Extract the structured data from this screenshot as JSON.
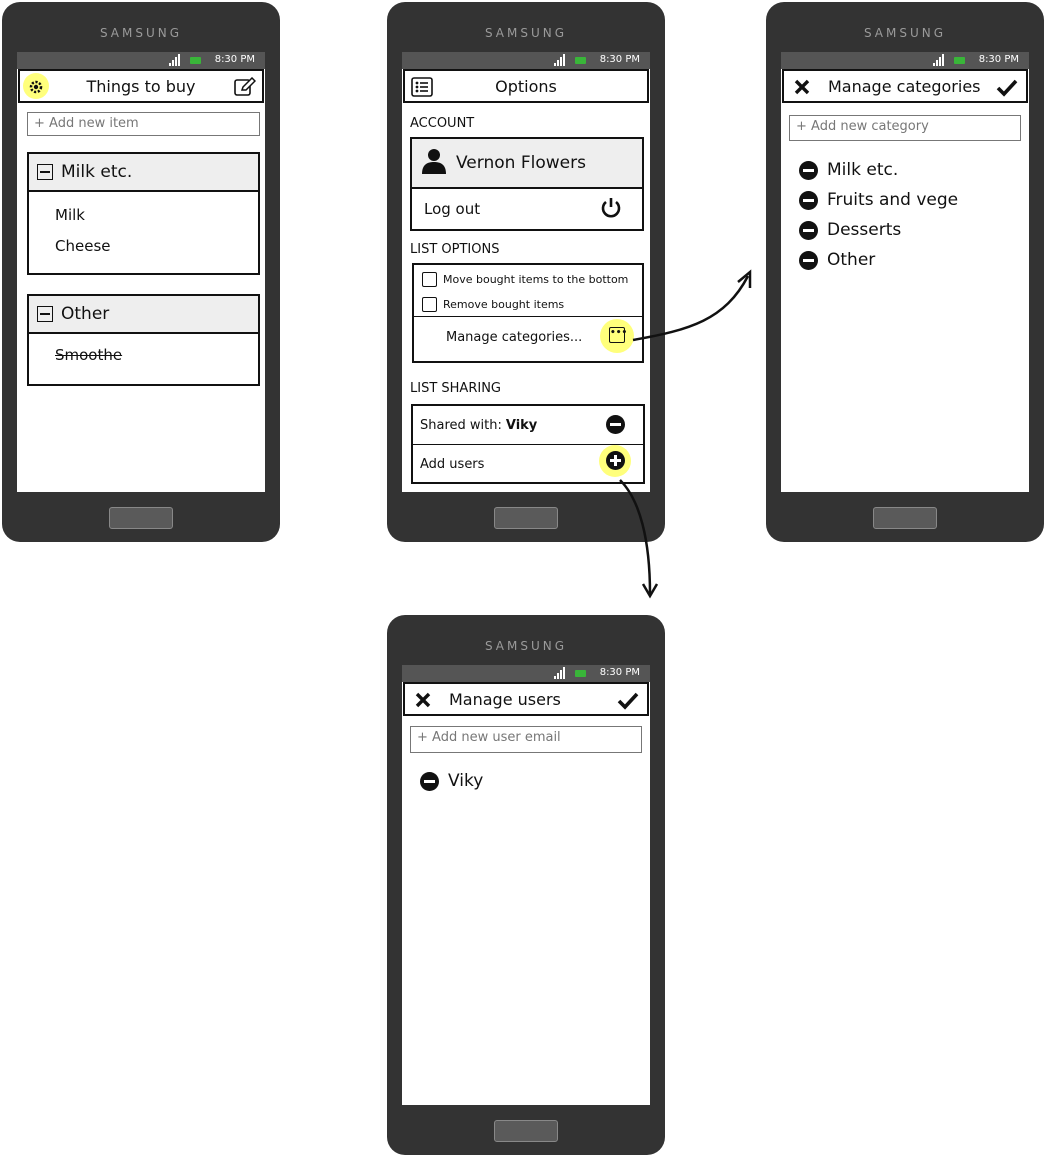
{
  "brand": "SAMSUNG",
  "status_time": "8:30 PM",
  "screen1": {
    "title": "Things to buy",
    "add_placeholder": "+ Add new item",
    "groups": [
      {
        "name": "Milk etc.",
        "items": [
          "Milk",
          "Cheese"
        ]
      },
      {
        "name": "Other",
        "items": [
          "Smoothe"
        ]
      }
    ]
  },
  "screen2": {
    "title": "Options",
    "account_label": "ACCOUNT",
    "user_name": "Vernon Flowers",
    "logout_label": "Log out",
    "list_options_label": "LIST OPTIONS",
    "option_move": "Move bought items to the bottom",
    "option_remove": "Remove bought items",
    "manage_categories": "Manage categories...",
    "list_sharing_label": "LIST SHARING",
    "shared_with_prefix": "Shared with:",
    "shared_with_user": "Viky",
    "add_users": "Add users"
  },
  "screen3": {
    "title": "Manage categories",
    "add_placeholder": "+ Add new category",
    "categories": [
      "Milk etc.",
      "Fruits and vege",
      "Desserts",
      "Other"
    ]
  },
  "screen4": {
    "title": "Manage users",
    "add_placeholder": "+ Add new user email",
    "users": [
      "Viky"
    ]
  },
  "colors": {
    "phone_body": "#333333",
    "highlight": "#ffff50",
    "battery": "#39b539"
  }
}
